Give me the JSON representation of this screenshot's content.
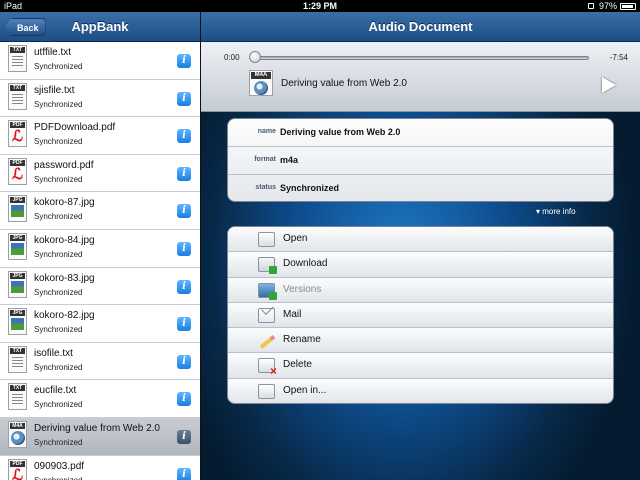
{
  "status_bar": {
    "carrier": "iPad",
    "time": "1:29 PM",
    "battery": "97%"
  },
  "left_pane": {
    "back_label": "Back",
    "title": "AppBank",
    "items": [
      {
        "name": "utffile.txt",
        "status": "Synchronized",
        "type": "TXT"
      },
      {
        "name": "sjisfile.txt",
        "status": "Synchronized",
        "type": "TXT"
      },
      {
        "name": "PDFDownload.pdf",
        "status": "Synchronized",
        "type": "PDF"
      },
      {
        "name": "password.pdf",
        "status": "Synchronized",
        "type": "PDF"
      },
      {
        "name": "kokoro-87.jpg",
        "status": "Synchronized",
        "type": "JPG"
      },
      {
        "name": "kokoro-84.jpg",
        "status": "Synchronized",
        "type": "JPG"
      },
      {
        "name": "kokoro-83.jpg",
        "status": "Synchronized",
        "type": "JPG"
      },
      {
        "name": "kokoro-82.jpg",
        "status": "Synchronized",
        "type": "JPG"
      },
      {
        "name": "isofile.txt",
        "status": "Synchronized",
        "type": "TXT"
      },
      {
        "name": "eucfile.txt",
        "status": "Synchronized",
        "type": "TXT"
      },
      {
        "name": "Deriving value from Web 2.0",
        "status": "Synchronized",
        "type": "M4A",
        "selected": true
      },
      {
        "name": "090903.pdf",
        "status": "Synchronized",
        "type": "PDF"
      }
    ],
    "info_glyph": "i"
  },
  "right_pane": {
    "title": "Audio Document",
    "player": {
      "elapsed": "0:00",
      "remaining": "-7:54",
      "progress": 0,
      "track_title": "Deriving value from Web 2.0",
      "icon_tag": "M4A"
    },
    "properties": [
      {
        "key": "name",
        "value": "Deriving value from Web 2.0"
      },
      {
        "key": "format",
        "value": "m4a"
      },
      {
        "key": "status",
        "value": "Synchronized"
      }
    ],
    "more_info": "▾ more info",
    "actions": [
      {
        "label": "Open",
        "icon": "open-icon",
        "enabled": true
      },
      {
        "label": "Download",
        "icon": "download-icon",
        "enabled": true
      },
      {
        "label": "Versions",
        "icon": "versions-icon",
        "enabled": false
      },
      {
        "label": "Mail",
        "icon": "mail-icon",
        "enabled": true
      },
      {
        "label": "Rename",
        "icon": "rename-icon",
        "enabled": true
      },
      {
        "label": "Delete",
        "icon": "delete-icon",
        "enabled": true
      },
      {
        "label": "Open in...",
        "icon": "open-in-icon",
        "enabled": true
      }
    ]
  },
  "colors": {
    "nav_bar": "#1d4e86",
    "info_button": "#1b7fe0",
    "background_glow": "#1f79c4"
  }
}
